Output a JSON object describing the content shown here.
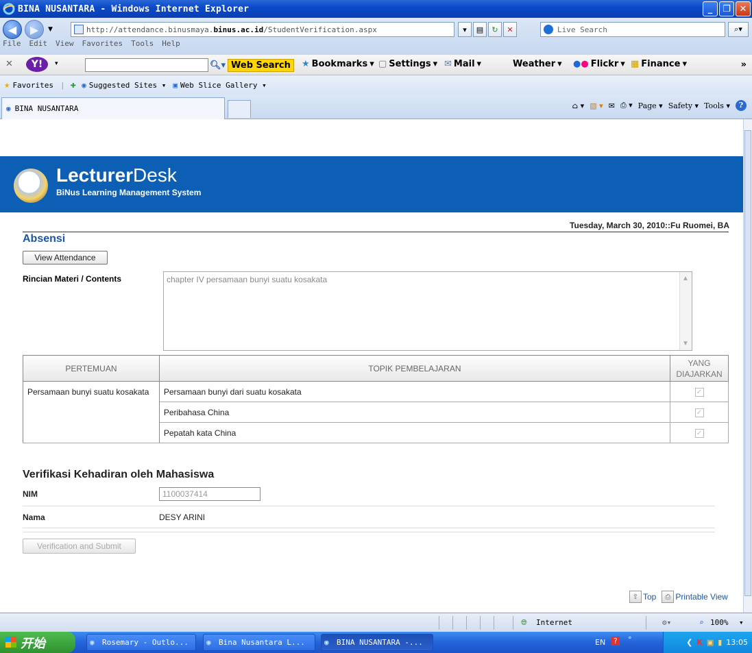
{
  "window": {
    "title": "BINA NUSANTARA - Windows Internet Explorer"
  },
  "address": {
    "url_prefix": "http://attendance.binusmaya.",
    "url_domain": "binus.ac.id",
    "url_suffix": "/StudentVerification.aspx",
    "search_placeholder": "Live Search"
  },
  "menu": [
    "File",
    "Edit",
    "View",
    "Favorites",
    "Tools",
    "Help"
  ],
  "yahoo": {
    "search_label": "Web Search",
    "bookmarks": "Bookmarks",
    "settings": "Settings",
    "mail": "Mail",
    "weather": "Weather",
    "flickr": "Flickr",
    "finance": "Finance"
  },
  "favorites": {
    "favorites": "Favorites",
    "suggested": "Suggested Sites",
    "webslice": "Web Slice Gallery"
  },
  "tab": {
    "label": "BINA NUSANTARA"
  },
  "commands": {
    "page": "Page",
    "safety": "Safety",
    "tools": "Tools"
  },
  "brand": {
    "name_bold": "Lecturer",
    "name_rest": "Desk",
    "subtitle": "BiNus Learning Management System"
  },
  "page": {
    "date_user": "Tuesday, March 30, 2010::Fu Ruomei, BA",
    "section_title": "Absensi",
    "view_attendance": "View Attendance",
    "contents_label": "Rincian Materi / Contents",
    "contents_text": "chapter IV  persamaan bunyi suatu kosakata"
  },
  "table": {
    "headers": [
      "PERTEMUAN",
      "TOPIK PEMBELAJARAN",
      "YANG DIAJARKAN"
    ],
    "pertemuan": "Persamaan bunyi suatu kosakata",
    "topics": [
      "Persamaan bunyi dari suatu kosakata",
      "Peribahasa China",
      "Pepatah kata China"
    ]
  },
  "verify": {
    "title": "Verifikasi Kehadiran oleh Mahasiswa",
    "nim_label": "NIM",
    "nim_value": "1100037414",
    "nama_label": "Nama",
    "nama_value": "DESY ARINI",
    "submit": "Verification and Submit"
  },
  "footer": {
    "top": "Top",
    "printable": "Printable View"
  },
  "status": {
    "zone": "Internet",
    "zoom": "100%"
  },
  "taskbar": {
    "start": "开始",
    "tasks": [
      "Rosemary - Outlo...",
      "Bina Nusantara L...",
      "BINA NUSANTARA -..."
    ],
    "lang": "EN",
    "clock": "13:05"
  }
}
